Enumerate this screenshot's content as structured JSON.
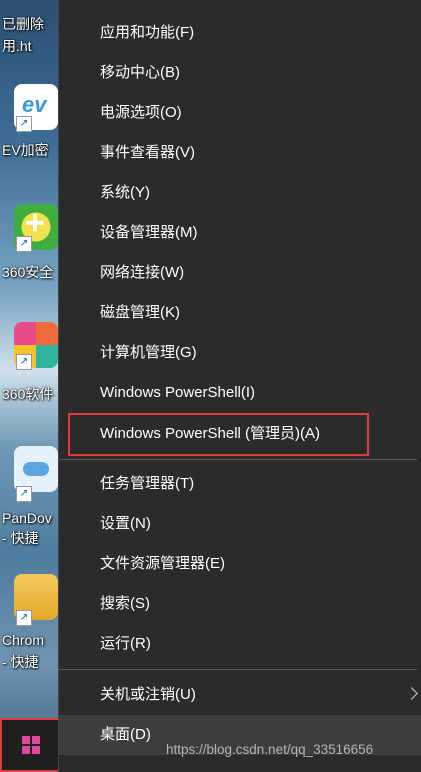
{
  "desktop": {
    "icons": [
      {
        "label": "已删除",
        "label2": "用.ht"
      },
      {
        "label": "EV加密"
      },
      {
        "label": "360安全"
      },
      {
        "label": "360软件"
      },
      {
        "label": "PanDov",
        "label2": "- 快捷"
      },
      {
        "label": "Chrom",
        "label2": "- 快捷"
      }
    ]
  },
  "menu": {
    "items": [
      {
        "label": "应用和功能(F)"
      },
      {
        "label": "移动中心(B)"
      },
      {
        "label": "电源选项(O)"
      },
      {
        "label": "事件查看器(V)"
      },
      {
        "label": "系统(Y)"
      },
      {
        "label": "设备管理器(M)"
      },
      {
        "label": "网络连接(W)"
      },
      {
        "label": "磁盘管理(K)"
      },
      {
        "label": "计算机管理(G)"
      },
      {
        "label": "Windows PowerShell(I)"
      },
      {
        "label": "Windows PowerShell (管理员)(A)"
      },
      {
        "label": "任务管理器(T)"
      },
      {
        "label": "设置(N)"
      },
      {
        "label": "文件资源管理器(E)"
      },
      {
        "label": "搜索(S)"
      },
      {
        "label": "运行(R)"
      },
      {
        "label": "关机或注销(U)"
      },
      {
        "label": "桌面(D)"
      }
    ]
  },
  "watermark": "https://blog.csdn.net/qq_33516656",
  "colors": {
    "menu_bg": "#2b2b2b",
    "highlight": "#e03c3c",
    "windows_logo": "#e0489d"
  }
}
